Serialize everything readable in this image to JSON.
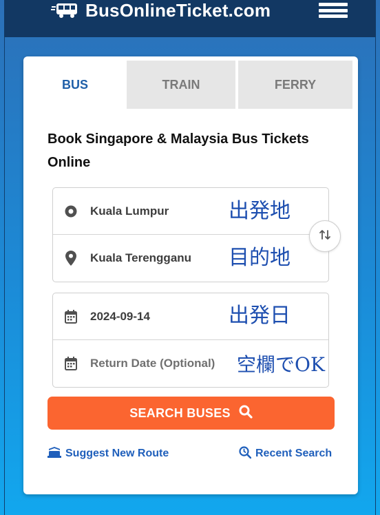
{
  "header": {
    "logo_text": "BusOnlineTicket.com"
  },
  "tabs": [
    {
      "label": "BUS"
    },
    {
      "label": "TRAIN"
    },
    {
      "label": "FERRY"
    }
  ],
  "headline": "Book Singapore & Malaysia Bus Tickets Online",
  "route": {
    "from_value": "Kuala Lumpur",
    "from_note": "出発地",
    "to_value": "Kuala Terengganu",
    "to_note": "目的地"
  },
  "dates": {
    "depart_value": "2024-09-14",
    "depart_note": "出発日",
    "return_placeholder": "Return Date (Optional)",
    "return_note": "空欄でOK"
  },
  "search_label": "SEARCH BUSES",
  "links": {
    "suggest": "Suggest New Route",
    "recent": "Recent Search"
  },
  "icons": {
    "origin": "origin-dot-icon",
    "destination": "map-pin-icon",
    "calendar": "calendar-icon",
    "swap": "swap-icon",
    "search": "search-icon",
    "suggest": "bus-route-icon",
    "recent": "recent-search-icon",
    "menu": "hamburger-menu-icon"
  },
  "colors": {
    "header_bg": "#123863",
    "accent_blue": "#1f5fa8",
    "search_button": "#fb6530",
    "annotation_text": "#1e4fb0"
  }
}
